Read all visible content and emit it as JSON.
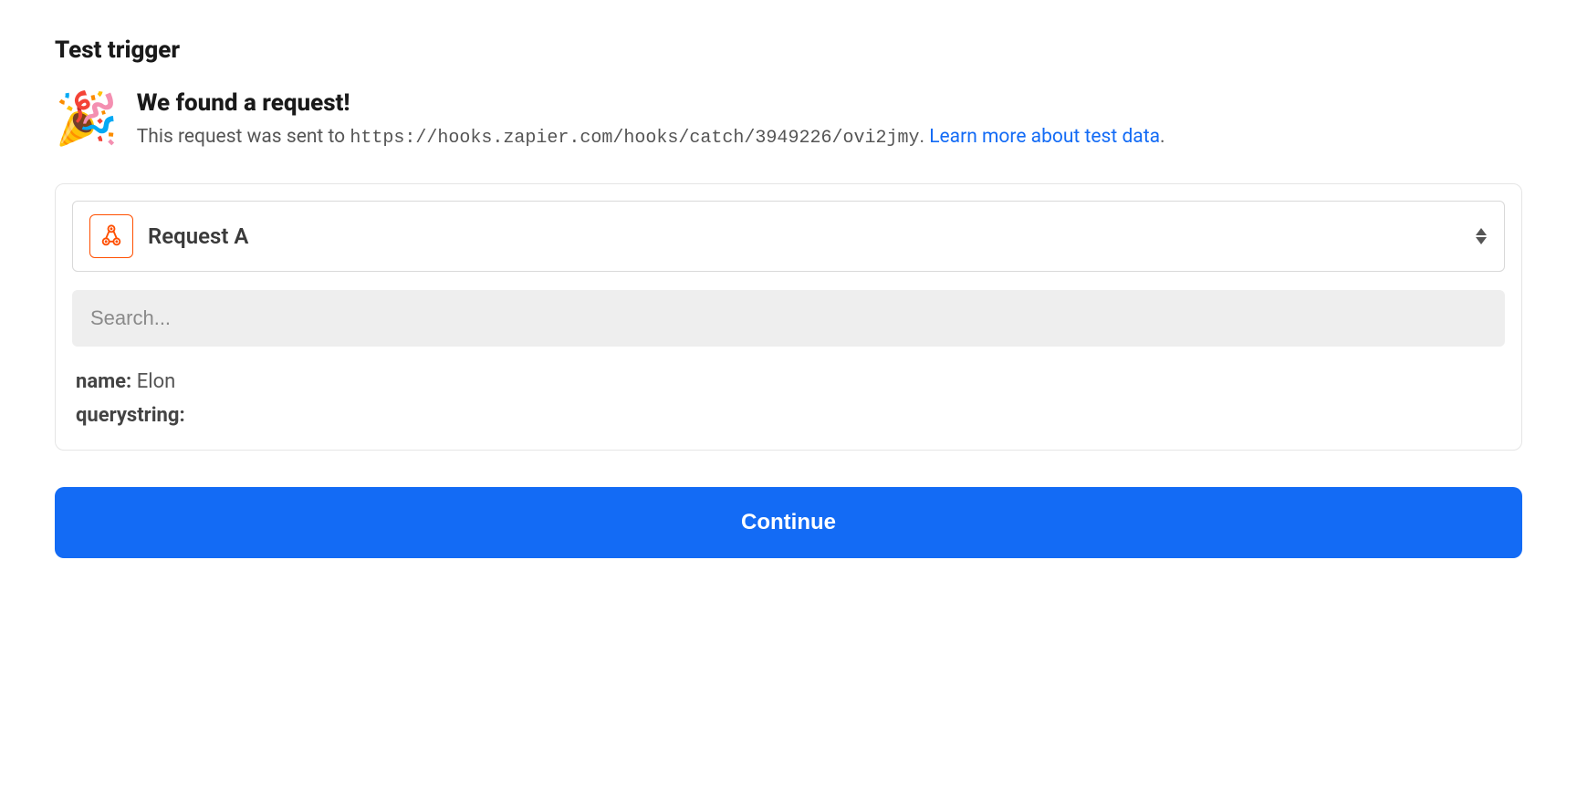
{
  "page": {
    "title": "Test trigger"
  },
  "found": {
    "icon": "🎉",
    "heading": "We found a request!",
    "desc_prefix": "This request was sent to ",
    "url": "https://hooks.zapier.com/hooks/catch/3949226/ovi2jmy",
    "period": ". ",
    "learn_link": "Learn more about test data",
    "trailing_period": "."
  },
  "panel": {
    "selector": {
      "label": "Request A"
    },
    "search": {
      "placeholder": "Search..."
    },
    "rows": [
      {
        "key": "name:",
        "value": "Elon"
      },
      {
        "key": "querystring:",
        "value": ""
      }
    ]
  },
  "button": {
    "continue": "Continue"
  }
}
